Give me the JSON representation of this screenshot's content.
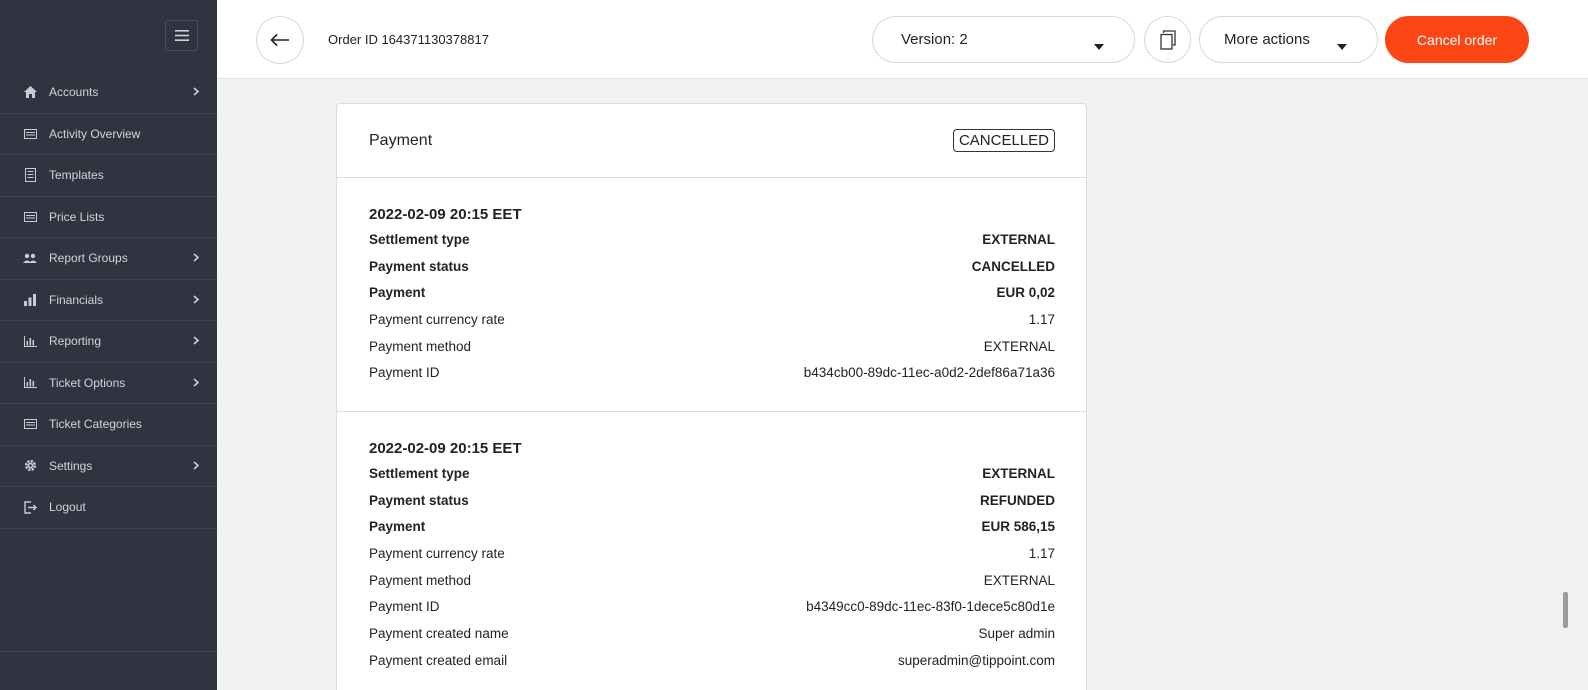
{
  "sidebar": {
    "items": [
      {
        "label": "Accounts",
        "icon": "home-icon",
        "chevron": true
      },
      {
        "label": "Activity Overview",
        "icon": "list-icon",
        "chevron": false
      },
      {
        "label": "Templates",
        "icon": "document-icon",
        "chevron": false
      },
      {
        "label": "Price Lists",
        "icon": "list-icon",
        "chevron": false
      },
      {
        "label": "Report Groups",
        "icon": "users-icon",
        "chevron": true
      },
      {
        "label": "Financials",
        "icon": "bar-chart-icon",
        "chevron": true
      },
      {
        "label": "Reporting",
        "icon": "bar-chart-icon",
        "chevron": true
      },
      {
        "label": "Ticket Options",
        "icon": "bar-chart-icon",
        "chevron": true
      },
      {
        "label": "Ticket Categories",
        "icon": "list-icon",
        "chevron": false
      },
      {
        "label": "Settings",
        "icon": "gear-icon",
        "chevron": true
      },
      {
        "label": "Logout",
        "icon": "logout-icon",
        "chevron": false
      }
    ]
  },
  "header": {
    "order_id": "Order ID 164371130378817",
    "version": "Version: 2",
    "more_actions": "More actions",
    "cancel_order": "Cancel order"
  },
  "colors": {
    "sidebar_bg": "#2f3440",
    "accent": "#fb4616"
  },
  "payment": {
    "title": "Payment",
    "status": "CANCELLED",
    "entries": [
      {
        "date": "2022-02-09 20:15 EET",
        "rows": [
          {
            "label": "Settlement type",
            "value": "EXTERNAL",
            "bold": true
          },
          {
            "label": "Payment status",
            "value": "CANCELLED",
            "bold": true
          },
          {
            "label": "Payment",
            "value": "EUR 0,02",
            "bold": true
          },
          {
            "label": "Payment currency rate",
            "value": "1.17",
            "bold": false
          },
          {
            "label": "Payment method",
            "value": "EXTERNAL",
            "bold": false
          },
          {
            "label": "Payment ID",
            "value": "b434cb00-89dc-11ec-a0d2-2def86a71a36",
            "bold": false
          }
        ]
      },
      {
        "date": "2022-02-09 20:15 EET",
        "rows": [
          {
            "label": "Settlement type",
            "value": "EXTERNAL",
            "bold": true
          },
          {
            "label": "Payment status",
            "value": "REFUNDED",
            "bold": true
          },
          {
            "label": "Payment",
            "value": "EUR 586,15",
            "bold": true
          },
          {
            "label": "Payment currency rate",
            "value": "1.17",
            "bold": false
          },
          {
            "label": "Payment method",
            "value": "EXTERNAL",
            "bold": false
          },
          {
            "label": "Payment ID",
            "value": "b4349cc0-89dc-11ec-83f0-1dece5c80d1e",
            "bold": false
          },
          {
            "label": "Payment created name",
            "value": "Super admin",
            "bold": false
          },
          {
            "label": "Payment created email",
            "value": "superadmin@tippoint.com",
            "bold": false
          }
        ]
      }
    ]
  }
}
